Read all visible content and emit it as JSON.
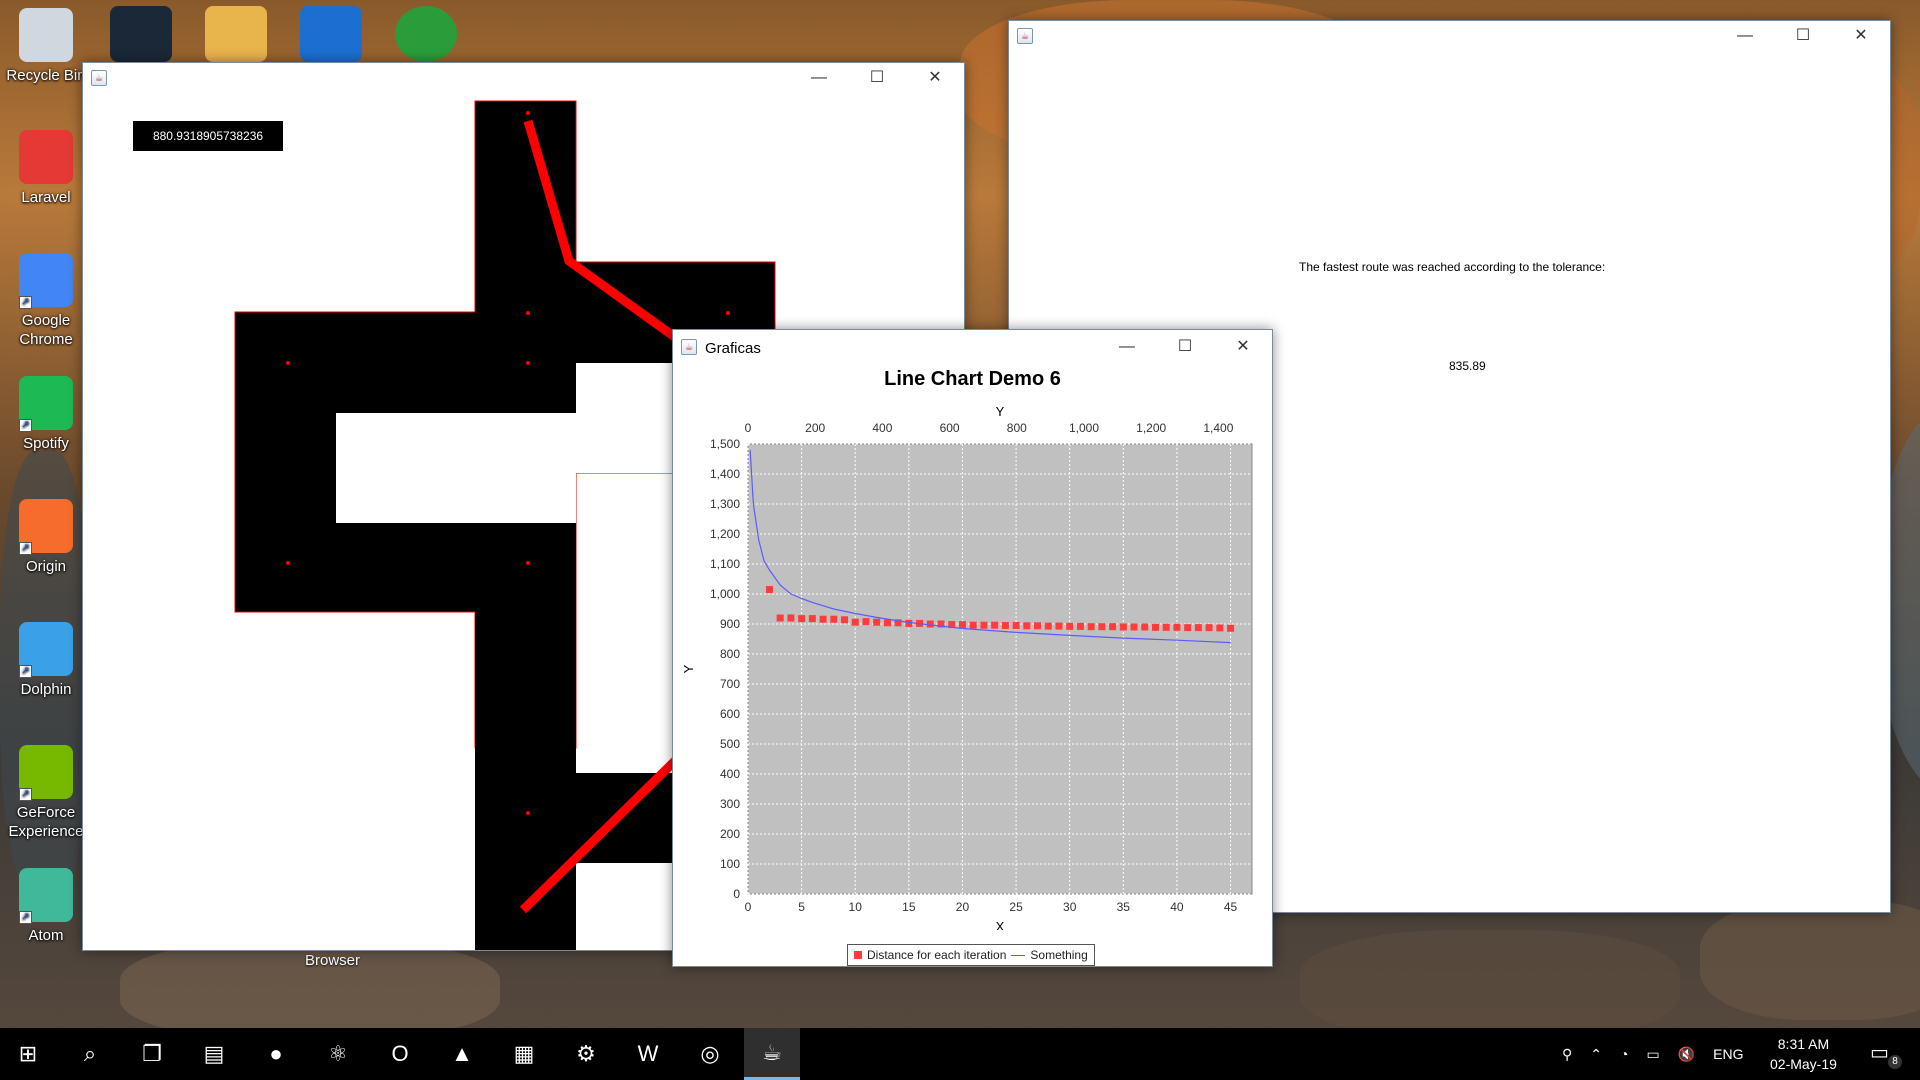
{
  "desktop": {
    "icons": [
      {
        "label": "Recycle Bin",
        "icon": "recycle-bin-icon",
        "color": "#d0d7de"
      },
      {
        "label": "Laravel",
        "icon": "pdf-icon",
        "color": "#e53935"
      },
      {
        "label": "Google Chrome",
        "icon": "chrome-icon",
        "color": "#4285f4"
      },
      {
        "label": "Spotify",
        "icon": "spotify-icon",
        "color": "#1db954"
      },
      {
        "label": "Origin",
        "icon": "origin-icon",
        "color": "#f56c2d"
      },
      {
        "label": "Dolphin",
        "icon": "dolphin-icon",
        "color": "#3aa0e8"
      },
      {
        "label": "GeForce Experience",
        "icon": "geforce-icon",
        "color": "#76b900"
      },
      {
        "label": "Atom",
        "icon": "atom-icon",
        "color": "#40b89a"
      }
    ],
    "browser_label": "Browser"
  },
  "map_window": {
    "distance_value": "880.9318905738236"
  },
  "result_window": {
    "message": "The fastest route was reached according to the tolerance:",
    "value": "835.89"
  },
  "chart_window": {
    "title": "Graficas",
    "legend": {
      "series1": "Distance for each iteration",
      "series2": "Something"
    }
  },
  "chart_data": {
    "type": "line",
    "title": "Line Chart Demo 6",
    "xlabel": "X",
    "ylabel": "Y",
    "top_axis_label": "Y",
    "xlim": [
      0,
      47
    ],
    "ylim": [
      0,
      1500
    ],
    "top_axis_range": [
      0,
      1500
    ],
    "x_ticks": [
      0,
      5,
      10,
      15,
      20,
      25,
      30,
      35,
      40,
      45
    ],
    "y_ticks": [
      0,
      100,
      200,
      300,
      400,
      500,
      600,
      700,
      800,
      900,
      1000,
      1100,
      1200,
      1300,
      1400,
      1500
    ],
    "top_ticks": [
      0,
      200,
      400,
      600,
      800,
      1000,
      1200,
      1400
    ],
    "grid": true,
    "legend_position": "bottom",
    "series": [
      {
        "name": "Distance for each iteration",
        "style": "points",
        "color": "#ff3b3b",
        "x": [
          2,
          3,
          4,
          5,
          6,
          7,
          8,
          9,
          10,
          11,
          12,
          13,
          14,
          15,
          16,
          17,
          18,
          19,
          20,
          21,
          22,
          23,
          24,
          25,
          26,
          27,
          28,
          29,
          30,
          31,
          32,
          33,
          34,
          35,
          36,
          37,
          38,
          39,
          40,
          41,
          42,
          43,
          44,
          45
        ],
        "y": [
          1015,
          920,
          920,
          918,
          918,
          916,
          916,
          914,
          906,
          908,
          906,
          904,
          904,
          902,
          902,
          900,
          900,
          898,
          898,
          896,
          896,
          896,
          895,
          895,
          894,
          894,
          893,
          893,
          892,
          892,
          891,
          891,
          891,
          890,
          890,
          890,
          889,
          889,
          889,
          888,
          888,
          888,
          887,
          886
        ]
      },
      {
        "name": "Something",
        "style": "line",
        "color": "#5b5bff",
        "x": [
          0.2,
          0.5,
          1,
          1.5,
          2,
          3,
          4,
          5,
          6,
          8,
          10,
          12,
          15,
          18,
          20,
          25,
          30,
          35,
          40,
          45
        ],
        "y": [
          1480,
          1300,
          1180,
          1110,
          1080,
          1030,
          1000,
          985,
          972,
          950,
          935,
          922,
          905,
          893,
          885,
          872,
          862,
          853,
          846,
          838
        ]
      }
    ]
  },
  "taskbar": {
    "apps": [
      {
        "name": "start-icon",
        "glyph": "⊞"
      },
      {
        "name": "search-icon",
        "glyph": "⌕"
      },
      {
        "name": "task-view-icon",
        "glyph": "❐"
      },
      {
        "name": "file-explorer-icon",
        "glyph": "▤"
      },
      {
        "name": "spotify-icon",
        "glyph": "●"
      },
      {
        "name": "atom-icon",
        "glyph": "⚛"
      },
      {
        "name": "opera-icon",
        "glyph": "O"
      },
      {
        "name": "matlab-icon",
        "glyph": "▲"
      },
      {
        "name": "calculator-icon",
        "glyph": "▦"
      },
      {
        "name": "settings-icon",
        "glyph": "⚙"
      },
      {
        "name": "word-icon",
        "glyph": "W"
      },
      {
        "name": "eclipse-icon",
        "glyph": "◎"
      },
      {
        "name": "java-icon",
        "glyph": "☕"
      }
    ],
    "language": "ENG",
    "time": "8:31 AM",
    "date": "02-May-19",
    "notifications": "8"
  }
}
